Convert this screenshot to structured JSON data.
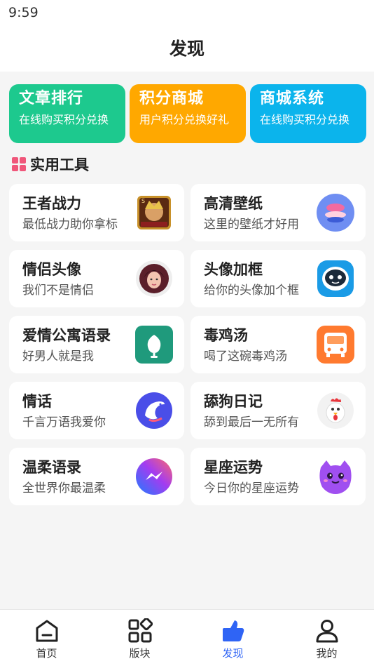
{
  "status_bar": {
    "time": "9:59"
  },
  "header": {
    "title": "发现"
  },
  "feature_cards": [
    {
      "title": "文章排行",
      "desc": "在线购买积分兑换",
      "color": "#1dc98e"
    },
    {
      "title": "积分商城",
      "desc": "用户积分兑换好礼",
      "color": "#ffa800"
    },
    {
      "title": "商城系统",
      "desc": "在线购买积分兑换",
      "color": "#0bb4ec"
    }
  ],
  "section": {
    "title": "实用工具",
    "icon": "grid-icon",
    "icon_color": "#f0567a"
  },
  "tools": [
    {
      "title": "王者战力",
      "desc": "最低战力助你拿标",
      "icon": "game-hero-icon"
    },
    {
      "title": "高清壁纸",
      "desc": "这里的壁纸才好用",
      "icon": "wallpaper-icon"
    },
    {
      "title": "情侣头像",
      "desc": "我们不是情侣",
      "icon": "avatar-portrait-icon"
    },
    {
      "title": "头像加框",
      "desc": "给你的头像加个框",
      "icon": "robot-frame-icon"
    },
    {
      "title": "爱情公寓语录",
      "desc": "好男人就是我",
      "icon": "chat-bubble-icon"
    },
    {
      "title": "毒鸡汤",
      "desc": "喝了这碗毒鸡汤",
      "icon": "bus-icon"
    },
    {
      "title": "情话",
      "desc": "千言万语我爱你",
      "icon": "dolphin-icon"
    },
    {
      "title": "舔狗日记",
      "desc": "舔到最后一无所有",
      "icon": "rooster-icon"
    },
    {
      "title": "温柔语录",
      "desc": "全世界你最温柔",
      "icon": "messenger-icon"
    },
    {
      "title": "星座运势",
      "desc": "今日你的星座运势",
      "icon": "purple-cat-icon"
    }
  ],
  "bottom_nav": {
    "items": [
      {
        "label": "首页",
        "icon": "home-icon"
      },
      {
        "label": "版块",
        "icon": "apps-icon"
      },
      {
        "label": "发现",
        "icon": "thumb-icon"
      },
      {
        "label": "我的",
        "icon": "user-icon"
      }
    ],
    "active": "发现",
    "active_color": "#2f64f5"
  }
}
